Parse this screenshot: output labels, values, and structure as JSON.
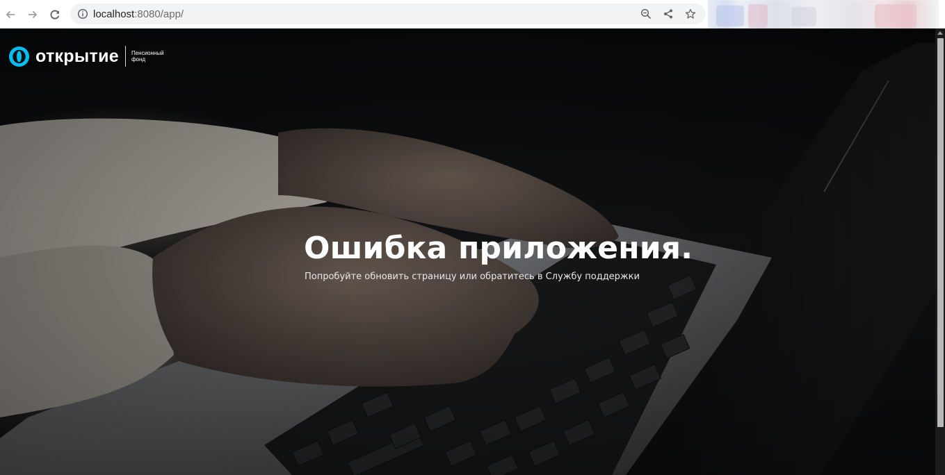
{
  "browser": {
    "url_host": "localhost",
    "url_rest": ":8080/app/",
    "back_icon": "arrow-left-icon",
    "forward_icon": "arrow-right-icon",
    "reload_icon": "reload-icon",
    "info_icon": "info-icon",
    "zoom_icon": "zoom-out-icon",
    "share_icon": "share-icon",
    "bookmark_icon": "star-icon"
  },
  "logo": {
    "wordmark": "открытие",
    "subtitle_line1": "Пенсионный",
    "subtitle_line2": "фонд",
    "brand_color": "#00bef0"
  },
  "error": {
    "title": "Ошибка приложения.",
    "subtitle": "Попробуйте обновить страницу или обратитесь в Службу поддержки"
  }
}
